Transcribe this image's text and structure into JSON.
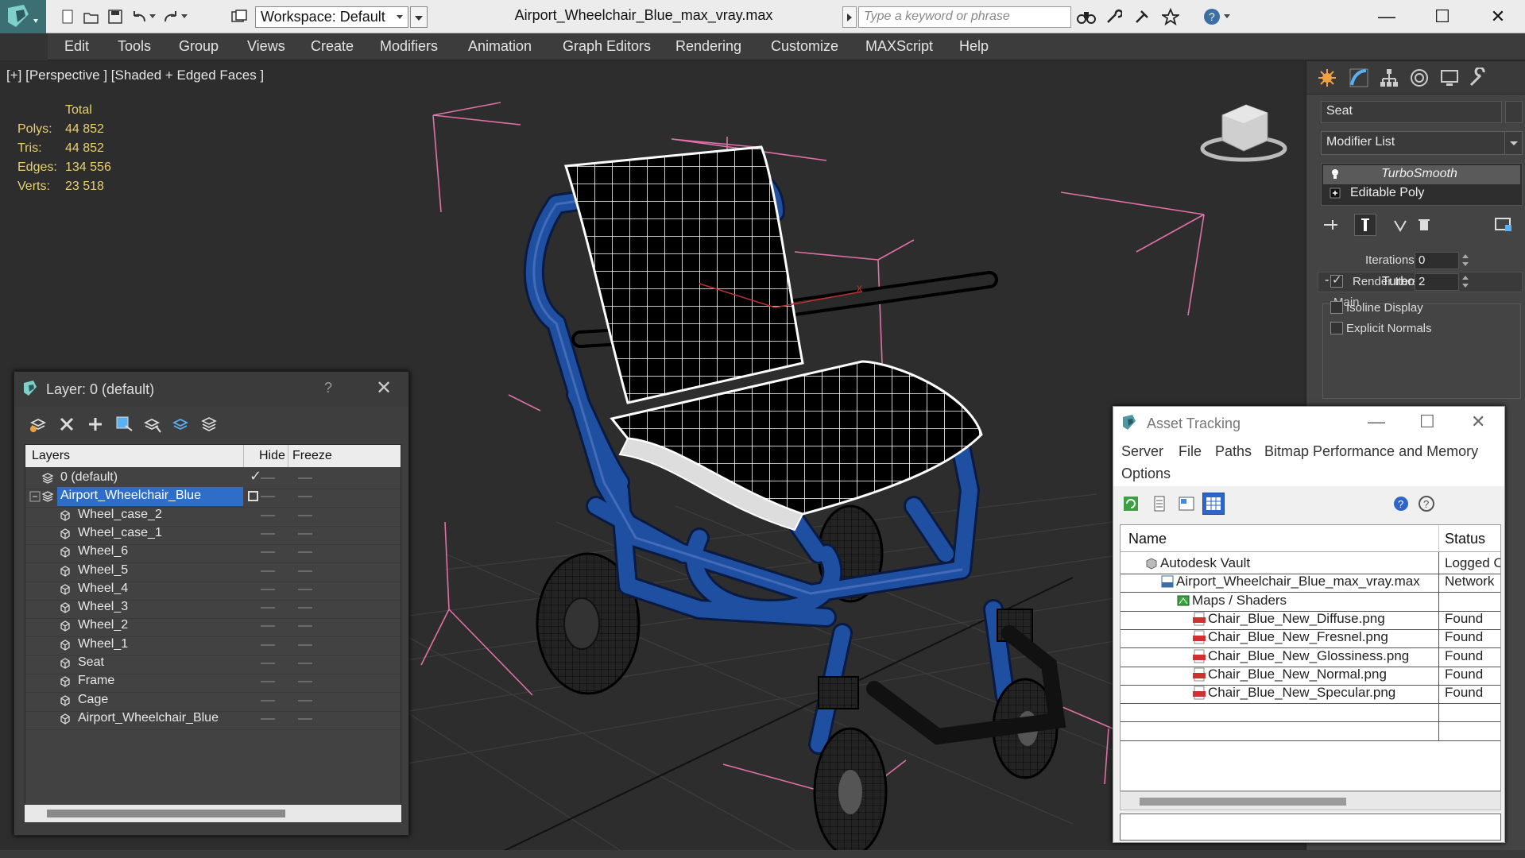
{
  "titlebar": {
    "workspace": "Workspace: Default",
    "window_title": "Airport_Wheelchair_Blue_max_vray.max",
    "search_placeholder": "Type a keyword or phrase",
    "minimize": "—",
    "maximize": "☐",
    "close": "✕"
  },
  "menu": [
    "Edit",
    "Tools",
    "Group",
    "Views",
    "Create",
    "Modifiers",
    "Animation",
    "Graph Editors",
    "Rendering",
    "Customize",
    "MAXScript",
    "Help"
  ],
  "viewport": {
    "label": "[+] [Perspective ] [Shaded + Edged Faces ]",
    "stats": {
      "total_label": "Total",
      "rows": [
        {
          "k": "Polys:",
          "v": "44 852"
        },
        {
          "k": "Tris:",
          "v": "44 852"
        },
        {
          "k": "Edges:",
          "v": "134 556"
        },
        {
          "k": "Verts:",
          "v": "23 518"
        }
      ]
    }
  },
  "command_panel": {
    "object_name": "Seat",
    "modifier_list": "Modifier List",
    "stack": [
      {
        "label": "TurboSmooth",
        "selected": true
      },
      {
        "label": "Editable Poly",
        "selected": false
      }
    ],
    "rollout": "TurboSmooth",
    "rollout_toggle": "-",
    "group": "Main",
    "iterations_label": "Iterations:",
    "iterations_value": "0",
    "render_iters_label": "Render Iters:",
    "render_iters_value": "2",
    "isoline_label": "Isoline Display",
    "explicit_label": "Explicit Normals"
  },
  "layer_window": {
    "title": "Layer: 0 (default)",
    "help": "?",
    "close": "✕",
    "col_layers": "Layers",
    "col_hide": "Hide",
    "col_freeze": "Freeze",
    "rows": [
      {
        "label": "0 (default)",
        "level": 0,
        "type": "layer"
      },
      {
        "label": "Airport_Wheelchair_Blue",
        "level": 0,
        "type": "layer",
        "selected": true
      },
      {
        "label": "Wheel_case_2",
        "level": 1,
        "type": "object"
      },
      {
        "label": "Wheel_case_1",
        "level": 1,
        "type": "object"
      },
      {
        "label": "Wheel_6",
        "level": 1,
        "type": "object"
      },
      {
        "label": "Wheel_5",
        "level": 1,
        "type": "object"
      },
      {
        "label": "Wheel_4",
        "level": 1,
        "type": "object"
      },
      {
        "label": "Wheel_3",
        "level": 1,
        "type": "object"
      },
      {
        "label": "Wheel_2",
        "level": 1,
        "type": "object"
      },
      {
        "label": "Wheel_1",
        "level": 1,
        "type": "object"
      },
      {
        "label": "Seat",
        "level": 1,
        "type": "object"
      },
      {
        "label": "Frame",
        "level": 1,
        "type": "object"
      },
      {
        "label": "Cage",
        "level": 1,
        "type": "object"
      },
      {
        "label": "Airport_Wheelchair_Blue",
        "level": 1,
        "type": "object"
      }
    ]
  },
  "asset_window": {
    "title": "Asset Tracking",
    "minimize": "—",
    "maximize": "☐",
    "close": "✕",
    "menu": [
      "Server",
      "File",
      "Paths",
      "Bitmap Performance and Memory",
      "Options"
    ],
    "col_name": "Name",
    "col_status": "Status",
    "rows": [
      {
        "name": "Autodesk Vault",
        "status": "Logged O",
        "level": 0,
        "icon": "vault"
      },
      {
        "name": "Airport_Wheelchair_Blue_max_vray.max",
        "status": "Network",
        "level": 1,
        "icon": "max"
      },
      {
        "name": "Maps / Shaders",
        "status": "",
        "level": 2,
        "icon": "maps"
      },
      {
        "name": "Chair_Blue_New_Diffuse.png",
        "status": "Found",
        "level": 3,
        "icon": "png"
      },
      {
        "name": "Chair_Blue_New_Fresnel.png",
        "status": "Found",
        "level": 3,
        "icon": "png"
      },
      {
        "name": "Chair_Blue_New_Glossiness.png",
        "status": "Found",
        "level": 3,
        "icon": "png"
      },
      {
        "name": "Chair_Blue_New_Normal.png",
        "status": "Found",
        "level": 3,
        "icon": "png"
      },
      {
        "name": "Chair_Blue_New_Specular.png",
        "status": "Found",
        "level": 3,
        "icon": "png"
      }
    ]
  },
  "colors": {
    "selection": "#2f6ec8",
    "frame_blue": "#1f4fa0",
    "stats_yellow": "#e8d070",
    "bbox_pink": "#e070a8"
  }
}
